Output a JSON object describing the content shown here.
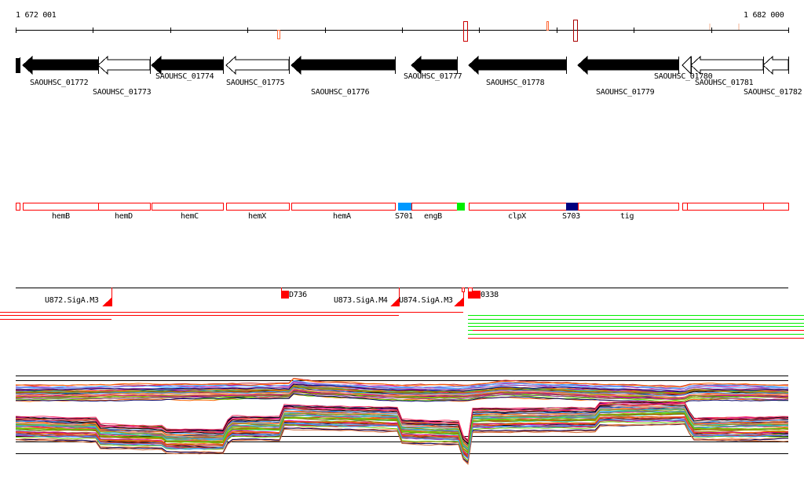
{
  "ruler": {
    "start_label": "1 672 001",
    "end_label": "1 682 000"
  },
  "genes": [
    {
      "id": "",
      "strand": "-",
      "fill": "black"
    },
    {
      "id": "SAOUHSC_01772",
      "strand": "-",
      "fill": "black"
    },
    {
      "id": "SAOUHSC_01773",
      "strand": "-",
      "fill": "white"
    },
    {
      "id": "SAOUHSC_01774",
      "strand": "-",
      "fill": "black"
    },
    {
      "id": "SAOUHSC_01775",
      "strand": "-",
      "fill": "white"
    },
    {
      "id": "SAOUHSC_01776",
      "strand": "-",
      "fill": "black"
    },
    {
      "id": "SAOUHSC_01777",
      "strand": "-",
      "fill": "black"
    },
    {
      "id": "SAOUHSC_01778",
      "strand": "-",
      "fill": "black"
    },
    {
      "id": "SAOUHSC_01779",
      "strand": "-",
      "fill": "black"
    },
    {
      "id": "SAOUHSC_01780",
      "strand": "-",
      "fill": "white"
    },
    {
      "id": "SAOUHSC_01781",
      "strand": "-",
      "fill": "white"
    },
    {
      "id": "SAOUHSC_01782",
      "strand": "-",
      "fill": "white"
    }
  ],
  "annotations": [
    {
      "name": "",
      "color": "#ff0000"
    },
    {
      "name": "hemB",
      "color": "#ff0000"
    },
    {
      "name": "hemD",
      "color": "#ff0000"
    },
    {
      "name": "hemC",
      "color": "#ff0000"
    },
    {
      "name": "hemX",
      "color": "#ff0000"
    },
    {
      "name": "hemA",
      "color": "#ff0000"
    },
    {
      "name": "S701",
      "color": "#0099ff"
    },
    {
      "name": "engB",
      "color": "#ff0000"
    },
    {
      "name": "",
      "color": "#00ee00"
    },
    {
      "name": "clpX",
      "color": "#ff0000"
    },
    {
      "name": "S703",
      "color": "#000080"
    },
    {
      "name": "tig",
      "color": "#ff0000"
    },
    {
      "name": "",
      "color": "#ff0000"
    },
    {
      "name": "",
      "color": "#ff0000"
    },
    {
      "name": "",
      "color": "#ff0000"
    }
  ],
  "transcripts": [
    {
      "label": "U872.SigA.M3"
    },
    {
      "label": "D736"
    },
    {
      "label": "U873.SigA.M4"
    },
    {
      "label": "U874.SigA.M3"
    },
    {
      "label": "0338"
    }
  ],
  "colors": {
    "minus_strand": "#ff0000",
    "plus_strand": "#00ee00",
    "expression_palette": [
      "#cc3333",
      "#ff6600",
      "#996600",
      "#66cc00",
      "#3399ff",
      "#cc0099",
      "#993399",
      "#ff9966",
      "#000066",
      "#999900",
      "#66aaff",
      "#cc6633",
      "#000000",
      "#ff3366",
      "#33cc99"
    ]
  }
}
